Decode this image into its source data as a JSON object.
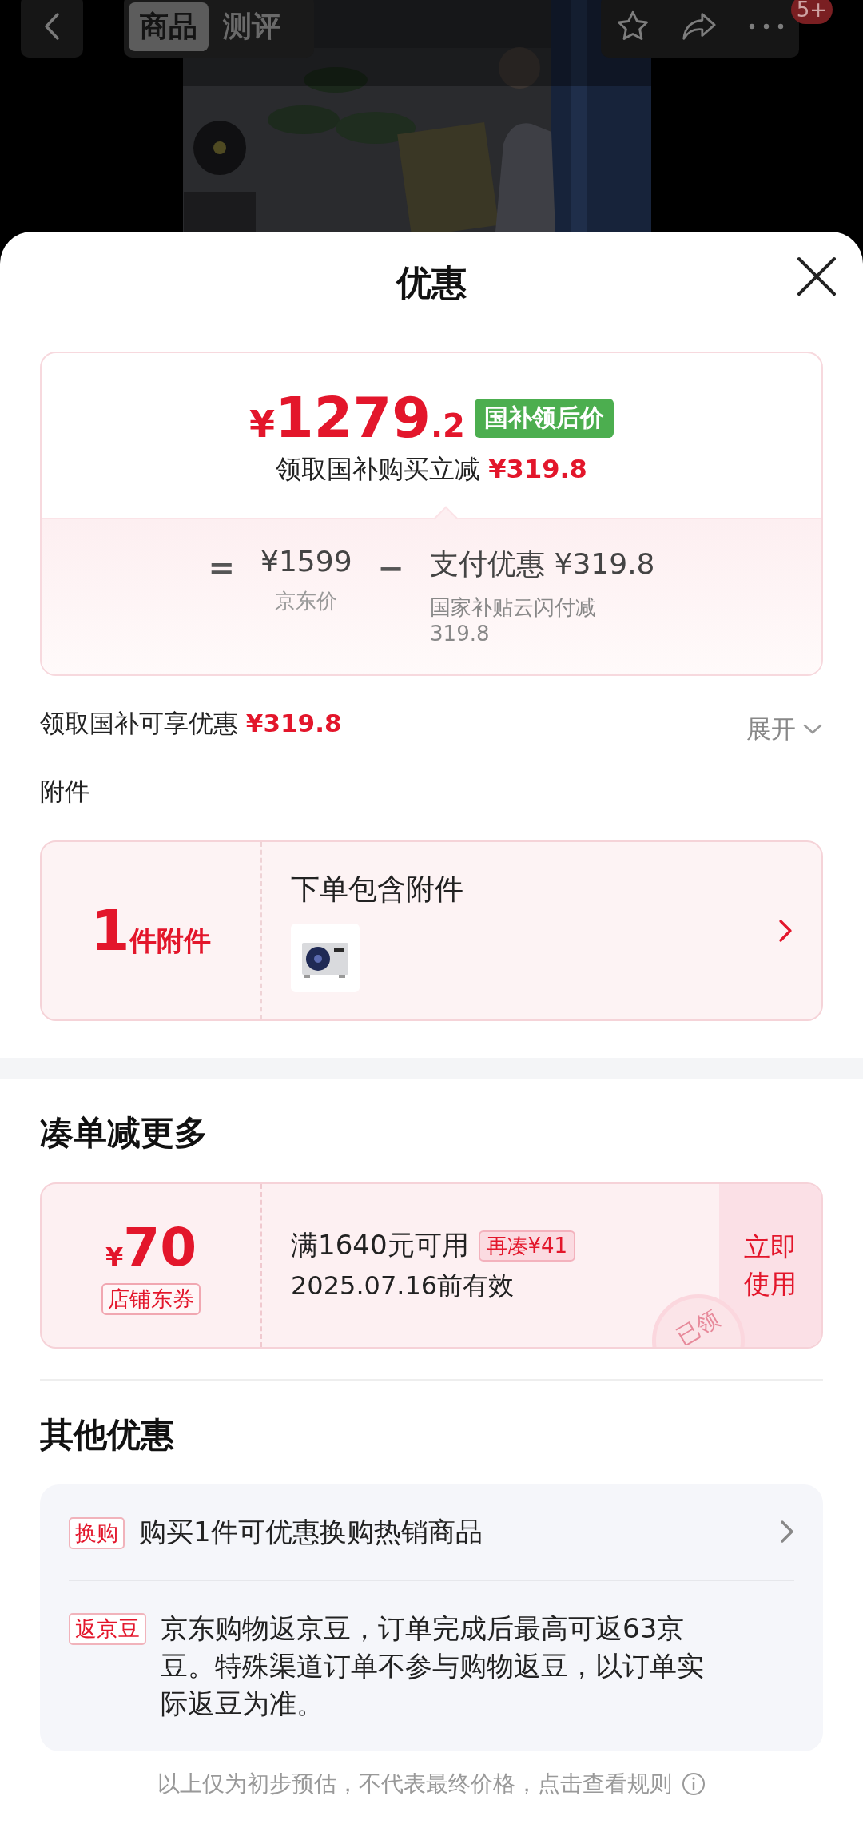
{
  "top_bar": {
    "tabs": [
      {
        "label": "商品",
        "selected": true
      },
      {
        "label": "测评",
        "selected": false
      }
    ],
    "badge": "5+"
  },
  "sheet": {
    "title": "优惠"
  },
  "price_card": {
    "currency": "¥",
    "price_integer": "1279",
    "price_decimal": ".2",
    "price_tag": "国补领后价",
    "subtitle": "领取国补购买立减",
    "subtitle_amount": "¥319.8",
    "equals": "=",
    "original_price": "¥1599",
    "original_label": "京东价",
    "minus": "−",
    "discount_label": "支付优惠",
    "discount_amount": "¥319.8",
    "discount_note": "国家补贴云闪付减319.8"
  },
  "savings": {
    "label": "领取国补可享优惠",
    "amount": "¥319.8",
    "toggle": "展开"
  },
  "accessories": {
    "heading": "附件",
    "count": "1",
    "count_unit": "件附件",
    "title": "下单包含附件"
  },
  "bundle": {
    "heading": "凑单减更多",
    "coupons": [
      {
        "currency": "¥",
        "amount": "70",
        "type": "店铺东券",
        "condition": "满1640元可用",
        "gap": "再凑¥41",
        "validity": "2025.07.16前有效",
        "action": "立即使用",
        "stamp": "已领"
      }
    ]
  },
  "other_offers": {
    "heading": "其他优惠",
    "items": [
      {
        "tag": "换购",
        "text": "购买1件可优惠换购热销商品",
        "link": true
      },
      {
        "tag": "返京豆",
        "text": "京东购物返京豆，订单完成后最高可返63京豆。特殊渠道订单不参与购物返豆，以订单实际返豆为准。",
        "link": false
      }
    ]
  },
  "footer": {
    "note": "以上仅为初步预估，不代表最终价格，点击查看规则"
  }
}
